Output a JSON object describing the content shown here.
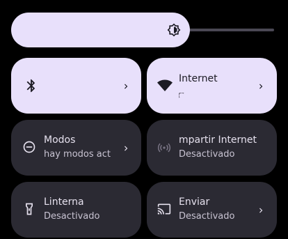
{
  "brightness": {
    "icon": "brightness-icon",
    "level": 0.6
  },
  "tiles": [
    {
      "id": "bluetooth",
      "state": "on",
      "icon": "bluetooth-icon",
      "title": "",
      "subtitle": "",
      "has_chevron": true
    },
    {
      "id": "internet",
      "state": "on",
      "icon": "wifi-icon",
      "title": "Internet",
      "subtitle": "",
      "has_chevron": true
    },
    {
      "id": "modos",
      "state": "off",
      "icon": "do-not-disturb-icon",
      "title": "Modos",
      "subtitle": "hay modos act",
      "has_chevron": true
    },
    {
      "id": "hotspot",
      "state": "off",
      "icon": "hotspot-icon",
      "title": "mpartir Internet",
      "subtitle": "Desactivado",
      "has_chevron": false
    },
    {
      "id": "linterna",
      "state": "off",
      "icon": "flashlight-icon",
      "title": "Linterna",
      "subtitle": "Desactivado",
      "has_chevron": false
    },
    {
      "id": "enviar",
      "state": "off",
      "icon": "cast-icon",
      "title": "Enviar",
      "subtitle": "Desactivado",
      "has_chevron": true
    }
  ],
  "colors": {
    "background": "#000000",
    "tile_on": "#e8e0fb",
    "tile_off": "#2b2a33",
    "text_on": "#1c1b24",
    "text_off": "#e6e1ee"
  }
}
